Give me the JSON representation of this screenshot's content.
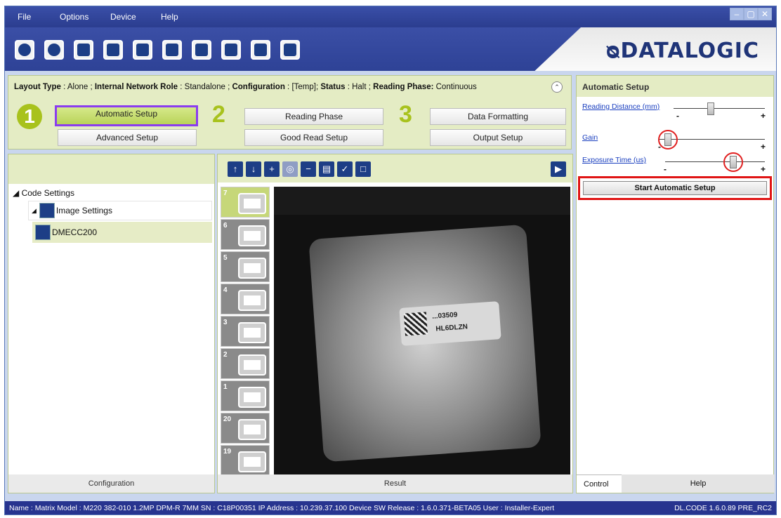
{
  "menu": [
    "File",
    "Options",
    "Device",
    "Help"
  ],
  "window_buttons": [
    "–",
    "▢",
    "✕"
  ],
  "logo": "ᴓDATALOGIC",
  "infobar": {
    "layout_type_label": "Layout Type",
    "layout_type_value": "Alone",
    "network_role_label": "Internal Network Role",
    "network_role_value": "Standalone",
    "configuration_label": "Configuration",
    "configuration_value": "[Temp]",
    "status_label": "Status",
    "status_value": "Halt",
    "reading_phase_label": "Reading Phase:",
    "reading_phase_value": "Continuous"
  },
  "steps": {
    "one": "1",
    "two": "2",
    "three": "3",
    "automatic_setup": "Automatic Setup",
    "advanced_setup": "Advanced Setup",
    "reading_phase": "Reading Phase",
    "good_read_setup": "Good Read Setup",
    "data_formatting": "Data Formatting",
    "output_setup": "Output Setup"
  },
  "right_panel": {
    "title": "Automatic Setup",
    "sliders": [
      {
        "label": "Reading Distance (mm)",
        "value": 0.4
      },
      {
        "label": "Gain",
        "value": 0.05
      },
      {
        "label": "Exposure Time (us)",
        "value": 0.7
      }
    ],
    "minus": "-",
    "plus": "+",
    "start_button": "Start Automatic Setup",
    "tabs": [
      "Control",
      "Help"
    ]
  },
  "tree": {
    "root": "Code Settings",
    "child": "Image Settings",
    "leaf": "DMECC200"
  },
  "left_footer": "Configuration",
  "center_footer": "Result",
  "thumbnails": [
    "7",
    "6",
    "5",
    "4",
    "3",
    "2",
    "1",
    "20",
    "19"
  ],
  "image_label": {
    "line1": "...03509",
    "line2": "HL6DLZN"
  },
  "statusbar": {
    "left": "Name : Matrix  Model : M220 382-010 1.2MP DPM-R 7MM  SN : C18P00351  IP Address : 10.239.37.100  Device SW Release : 1.6.0.371-BETA05  User : Installer-Expert",
    "right": "DL.CODE 1.6.0.89 PRE_RC2"
  }
}
